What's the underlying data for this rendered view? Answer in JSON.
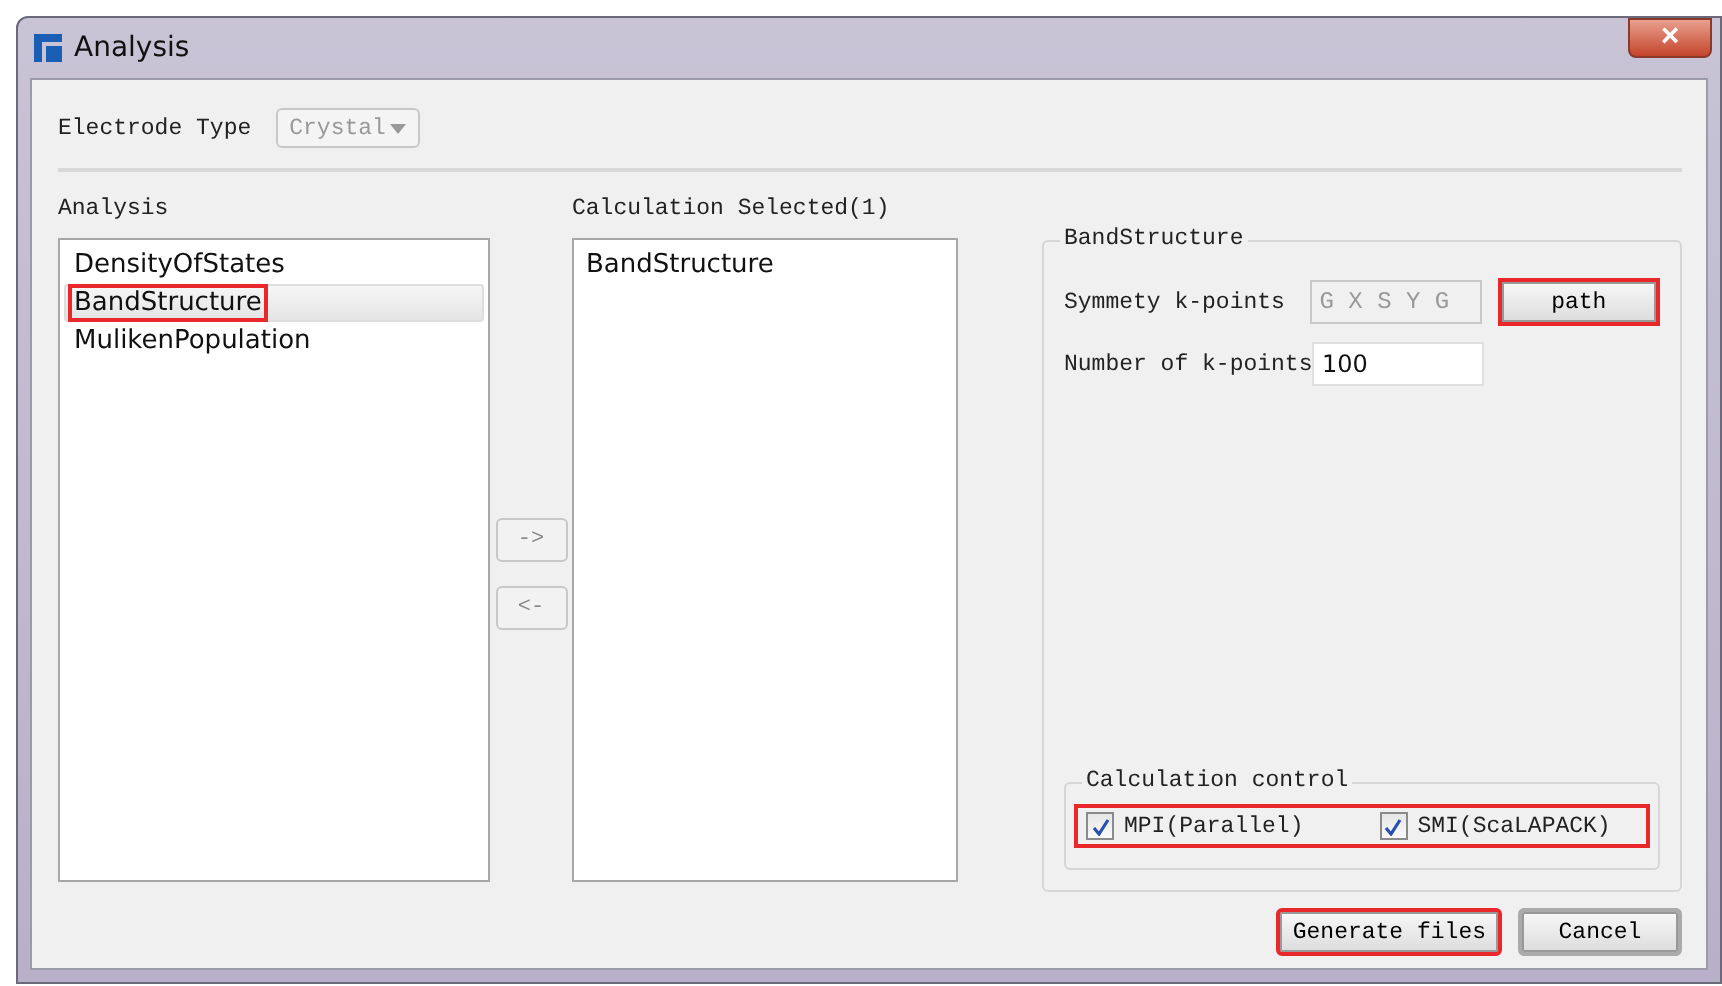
{
  "window": {
    "title": "Analysis",
    "close": "×"
  },
  "electrode": {
    "label": "Electrode Type",
    "value": "Crystal",
    "disabled": true
  },
  "analysis": {
    "label": "Analysis",
    "items": [
      {
        "text": "DensityOfStates",
        "selected": false,
        "highlighted": false
      },
      {
        "text": "BandStructure",
        "selected": true,
        "highlighted": true
      },
      {
        "text": "MulikenPopulation",
        "selected": false,
        "highlighted": false
      }
    ]
  },
  "move_buttons": [
    "->",
    "<-"
  ],
  "selected_list": {
    "label": "Calculation Selected(1)",
    "items": [
      "BandStructure"
    ]
  },
  "band_structure": {
    "title": "BandStructure",
    "symmetry": {
      "label": "Symmety k-points",
      "value": "G X S Y G",
      "disabled": true
    },
    "path_button": {
      "label": "path",
      "highlighted": true
    },
    "kpoints": {
      "label": "Number of k-points",
      "value": "100"
    }
  },
  "calculation_control": {
    "title": "Calculation control",
    "highlighted": true,
    "options": [
      {
        "label": "MPI(Parallel)",
        "checked": true
      },
      {
        "label": "SMI(ScaLAPACK)",
        "checked": true
      }
    ]
  },
  "buttons": [
    {
      "label": "Generate files",
      "highlighted": true
    },
    {
      "label": "Cancel",
      "highlighted": false
    }
  ]
}
